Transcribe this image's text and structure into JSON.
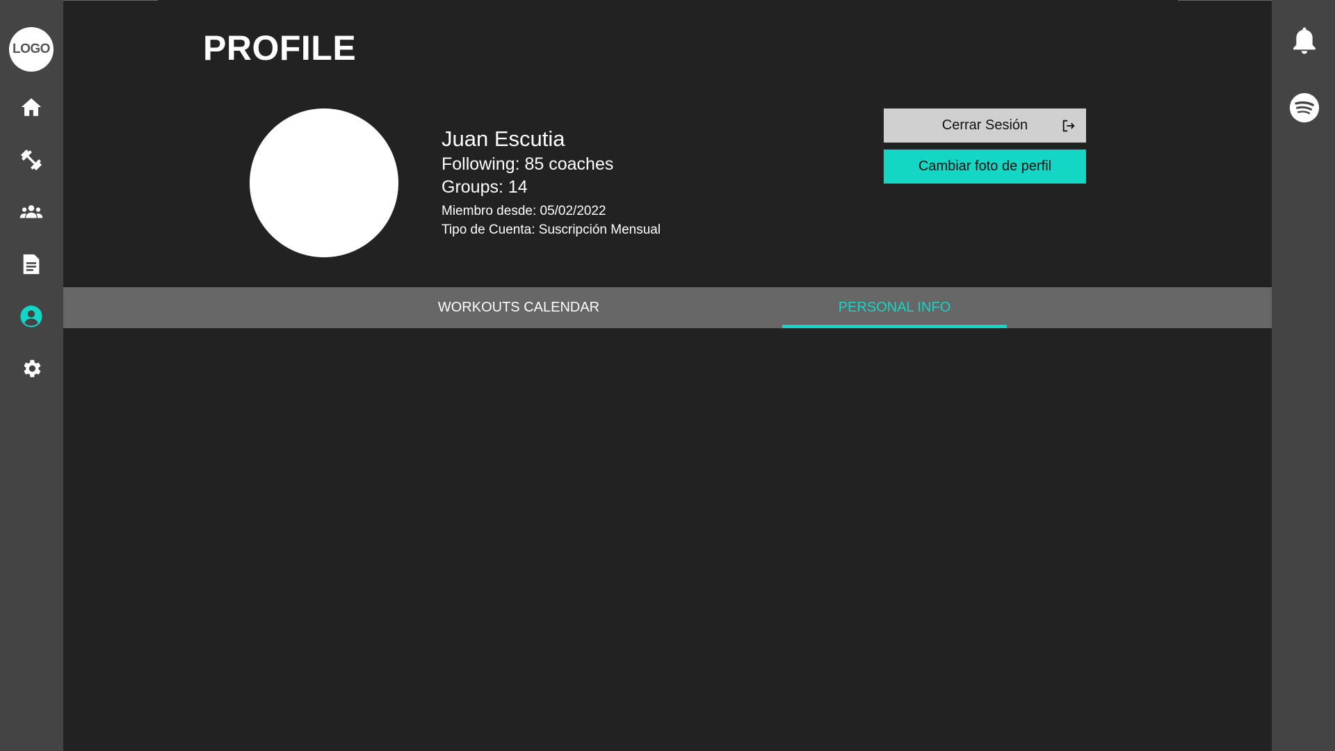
{
  "sidebar": {
    "logo_text": "LOGO",
    "items": [
      {
        "icon": "home-icon",
        "active": false
      },
      {
        "icon": "dumbbell-icon",
        "active": false
      },
      {
        "icon": "groups-icon",
        "active": false
      },
      {
        "icon": "document-icon",
        "active": false
      },
      {
        "icon": "profile-icon",
        "active": true
      },
      {
        "icon": "gear-icon",
        "active": false
      }
    ]
  },
  "right_sidebar": {
    "items": [
      {
        "icon": "bell-icon"
      },
      {
        "icon": "spotify-icon"
      }
    ]
  },
  "page": {
    "title": "PROFILE"
  },
  "profile": {
    "name": "Juan Escutia",
    "following": "Following: 85 coaches",
    "groups": "Groups: 14",
    "member_since": "Miembro desde: 05/02/2022",
    "account_type": "Tipo de Cuenta: Suscripción Mensual"
  },
  "actions": {
    "logout_label": "Cerrar Sesión",
    "change_photo_label": "Cambiar foto de perfil"
  },
  "tabs": [
    {
      "label": "WORKOUTS CALENDAR",
      "active": false
    },
    {
      "label": "PERSONAL INFO",
      "active": true
    }
  ],
  "colors": {
    "accent": "#14d6c4",
    "background": "#222222",
    "sidebar": "#444444",
    "tab_bar": "#666666",
    "icon_default": "#ffffff"
  }
}
